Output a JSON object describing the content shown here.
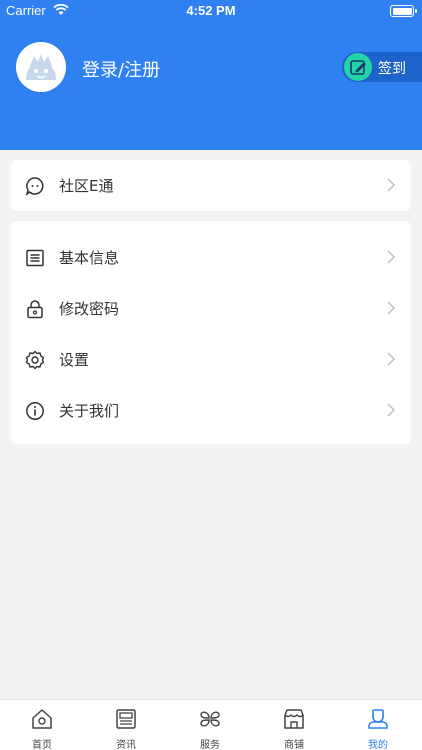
{
  "status_bar": {
    "carrier": "Carrier",
    "time": "4:52 PM"
  },
  "header": {
    "login_label": "登录/注册",
    "checkin_label": "签到",
    "accent": "#2f80f0"
  },
  "card1": {
    "items": [
      {
        "label": "社区E通",
        "icon": "message-icon"
      }
    ]
  },
  "card2": {
    "items": [
      {
        "label": "基本信息",
        "icon": "list-icon"
      },
      {
        "label": "修改密码",
        "icon": "lock-icon"
      },
      {
        "label": "设置",
        "icon": "gear-icon"
      },
      {
        "label": "关于我们",
        "icon": "info-icon"
      }
    ]
  },
  "tabbar": {
    "tabs": [
      {
        "label": "首页",
        "icon": "home-icon"
      },
      {
        "label": "资讯",
        "icon": "news-icon"
      },
      {
        "label": "服务",
        "icon": "service-icon"
      },
      {
        "label": "商铺",
        "icon": "shop-icon"
      },
      {
        "label": "我的",
        "icon": "profile-icon",
        "active": true
      }
    ]
  }
}
